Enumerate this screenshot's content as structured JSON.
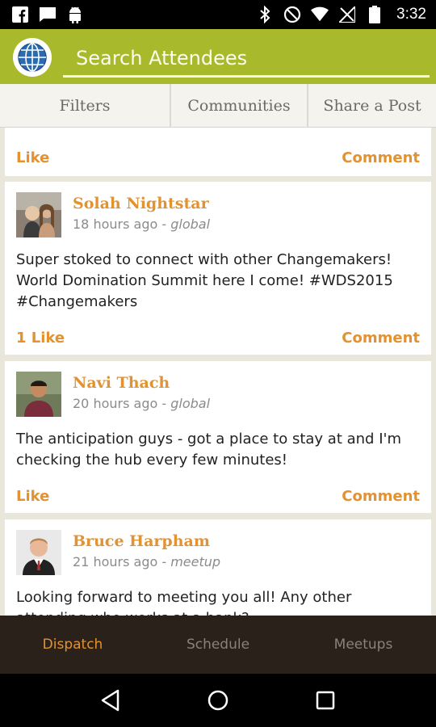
{
  "status_bar": {
    "time": "3:32",
    "left_icons": [
      "facebook-icon",
      "chat-icon",
      "android-icon"
    ],
    "right_icons": [
      "bluetooth-icon",
      "do-not-disturb-icon",
      "wifi-icon",
      "no-signal-icon",
      "battery-icon"
    ]
  },
  "header": {
    "search_placeholder": "Search Attendees",
    "logo_icon": "globe-icon",
    "accent_color": "#a8ba2c"
  },
  "top_tabs": [
    {
      "label": "Filters"
    },
    {
      "label": "Communities"
    },
    {
      "label": "Share a Post"
    }
  ],
  "feed": {
    "partial_card": {
      "like_label": "Like",
      "comment_label": "Comment"
    },
    "posts": [
      {
        "author": "Solah Nightstar",
        "time_ago": "18 hours ago - ",
        "scope": "global",
        "text": "Super stoked to connect with other Changemakers! World Domination Summit here I come! #WDS2015 #Changemakers",
        "like_label": "1 Like",
        "comment_label": "Comment"
      },
      {
        "author": "Navi Thach",
        "time_ago": "20 hours ago - ",
        "scope": "global",
        "text": "The anticipation guys - got a place to stay at and I'm checking the hub every few minutes!",
        "like_label": "Like",
        "comment_label": "Comment"
      },
      {
        "author": "Bruce Harpham",
        "time_ago": "21 hours ago - ",
        "scope": "meetup",
        "text": "Looking forward to meeting you all! Any other attending who works at a bank?",
        "like_label": "Like",
        "comment_label": "Comment"
      }
    ],
    "link_color": "#e29230"
  },
  "bottom_nav": [
    {
      "label": "Dispatch",
      "active": true
    },
    {
      "label": "Schedule",
      "active": false
    },
    {
      "label": "Meetups",
      "active": false
    }
  ],
  "system_nav": [
    "back-icon",
    "home-icon",
    "recents-icon"
  ]
}
